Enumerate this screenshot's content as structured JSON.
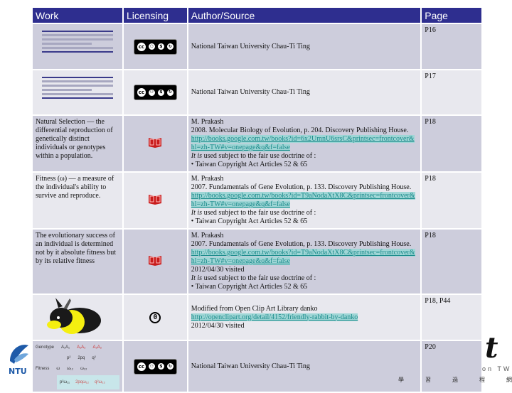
{
  "table": {
    "headers": {
      "work": "Work",
      "licensing": "Licensing",
      "author": "Author/Source",
      "page": "Page"
    },
    "rows": [
      {
        "work_type": "table-thumbnail",
        "license_icon": "cc-by-nc-sa-icon",
        "author_lines": [
          "National Taiwan University Chau-Ti Ting"
        ],
        "page": "P16"
      },
      {
        "work_type": "table-thumbnail",
        "license_icon": "cc-by-nc-sa-icon",
        "author_lines": [
          "National Taiwan University Chau-Ti Ting"
        ],
        "page": "P17"
      },
      {
        "work_text": "Natural Selection — the differential reproduction of genetically distinct individuals or genotypes within a population.",
        "license_icon": "fair-use-book-icon",
        "author": "M. Prakash",
        "citation": "2008. Molecular Biology of Evolution, p. 204. Discovery Publishing House.",
        "link": "http://books.google.com.tw/books?id=6x2UmnU6srsC&printsec=frontcover&hl=zh-TW#v=onepage&q&f=false",
        "visited": "",
        "fair_use_prefix": "It is",
        "fair_use": " used subject to the fair use doctrine of :",
        "article": "• Taiwan Copyright Act Articles 52 & 65",
        "page": "P18"
      },
      {
        "work_text": "Fitness (ω) — a measure of the individual's ability to survive and reproduce.",
        "license_icon": "fair-use-book-icon",
        "author": "M. Prakash",
        "citation": "2007. Fundamentals of Gene Evolution, p. 133. Discovery Publishing House.",
        "link": "http://books.google.com.tw/books?id=T9aNodaXtX8C&printsec=frontcover&hl=zh-TW#v=onepage&q&f=false",
        "visited": "",
        "fair_use_prefix": "It is",
        "fair_use": " used subject to the fair use doctrine of :",
        "article": "• Taiwan Copyright Act Articles 52 & 65",
        "page": "P18"
      },
      {
        "work_text": "The evolutionary success of an individual is determined not by it absolute fitness but by its relative fitness",
        "license_icon": "fair-use-book-icon",
        "author": "M. Prakash",
        "citation": "2007. Fundamentals of Gene Evolution, p. 133. Discovery Publishing House.",
        "link": "http://books.google.com.tw/books?id=T9aNodaXtX8C&printsec=frontcover&hl=zh-TW#v=onepage&q&f=false",
        "visited": "2012/04/30 visited",
        "fair_use_prefix": "It is",
        "fair_use": " used subject to the fair use doctrine of :",
        "article": "• Taiwan Copyright Act Articles 52 & 65",
        "page": "P18"
      },
      {
        "work_type": "rabbit-image",
        "license_icon": "public-domain-zero-icon",
        "author": "Modified from Open Clip Art Library danko",
        "link": "http://openclipart.org/detail/4152/friendly-rabbit-by-danko",
        "visited": "2012/04/30 visited",
        "page": "P18, P44"
      },
      {
        "work_type": "genotype-fitness-diagram",
        "genotype_label": "Genotype",
        "genotypes": [
          "A₁A₁",
          "A₁A₂",
          "A₂A₂"
        ],
        "frequencies": [
          "p²",
          "2pq",
          "q²"
        ],
        "fitness_label": "Fitness",
        "fitness": [
          "ω",
          "ω₁₂",
          "ω₂₂"
        ],
        "products": [
          "p²ω₁₁",
          "2pqω₁₂",
          "q²ω₂₂"
        ],
        "license_icon": "cc-by-nc-sa-icon",
        "author_lines": [
          "National Taiwan University Chau-Ti Ting"
        ],
        "page": "P20"
      }
    ]
  },
  "cc_labels": {
    "by": "BY",
    "nc": "NC",
    "sa": "SA",
    "cc": "cc",
    "zero": "0"
  },
  "logos": {
    "left": "NTU",
    "right_letter": "t",
    "right_sub": "on TW"
  },
  "footer_chars": [
    "學",
    "習",
    "過",
    "程",
    "網"
  ],
  "colors": {
    "header_bg": "#2e2e8f",
    "row_dark": "#cdcddc",
    "row_light": "#e8e8ee",
    "link": "#1b8b8b"
  }
}
